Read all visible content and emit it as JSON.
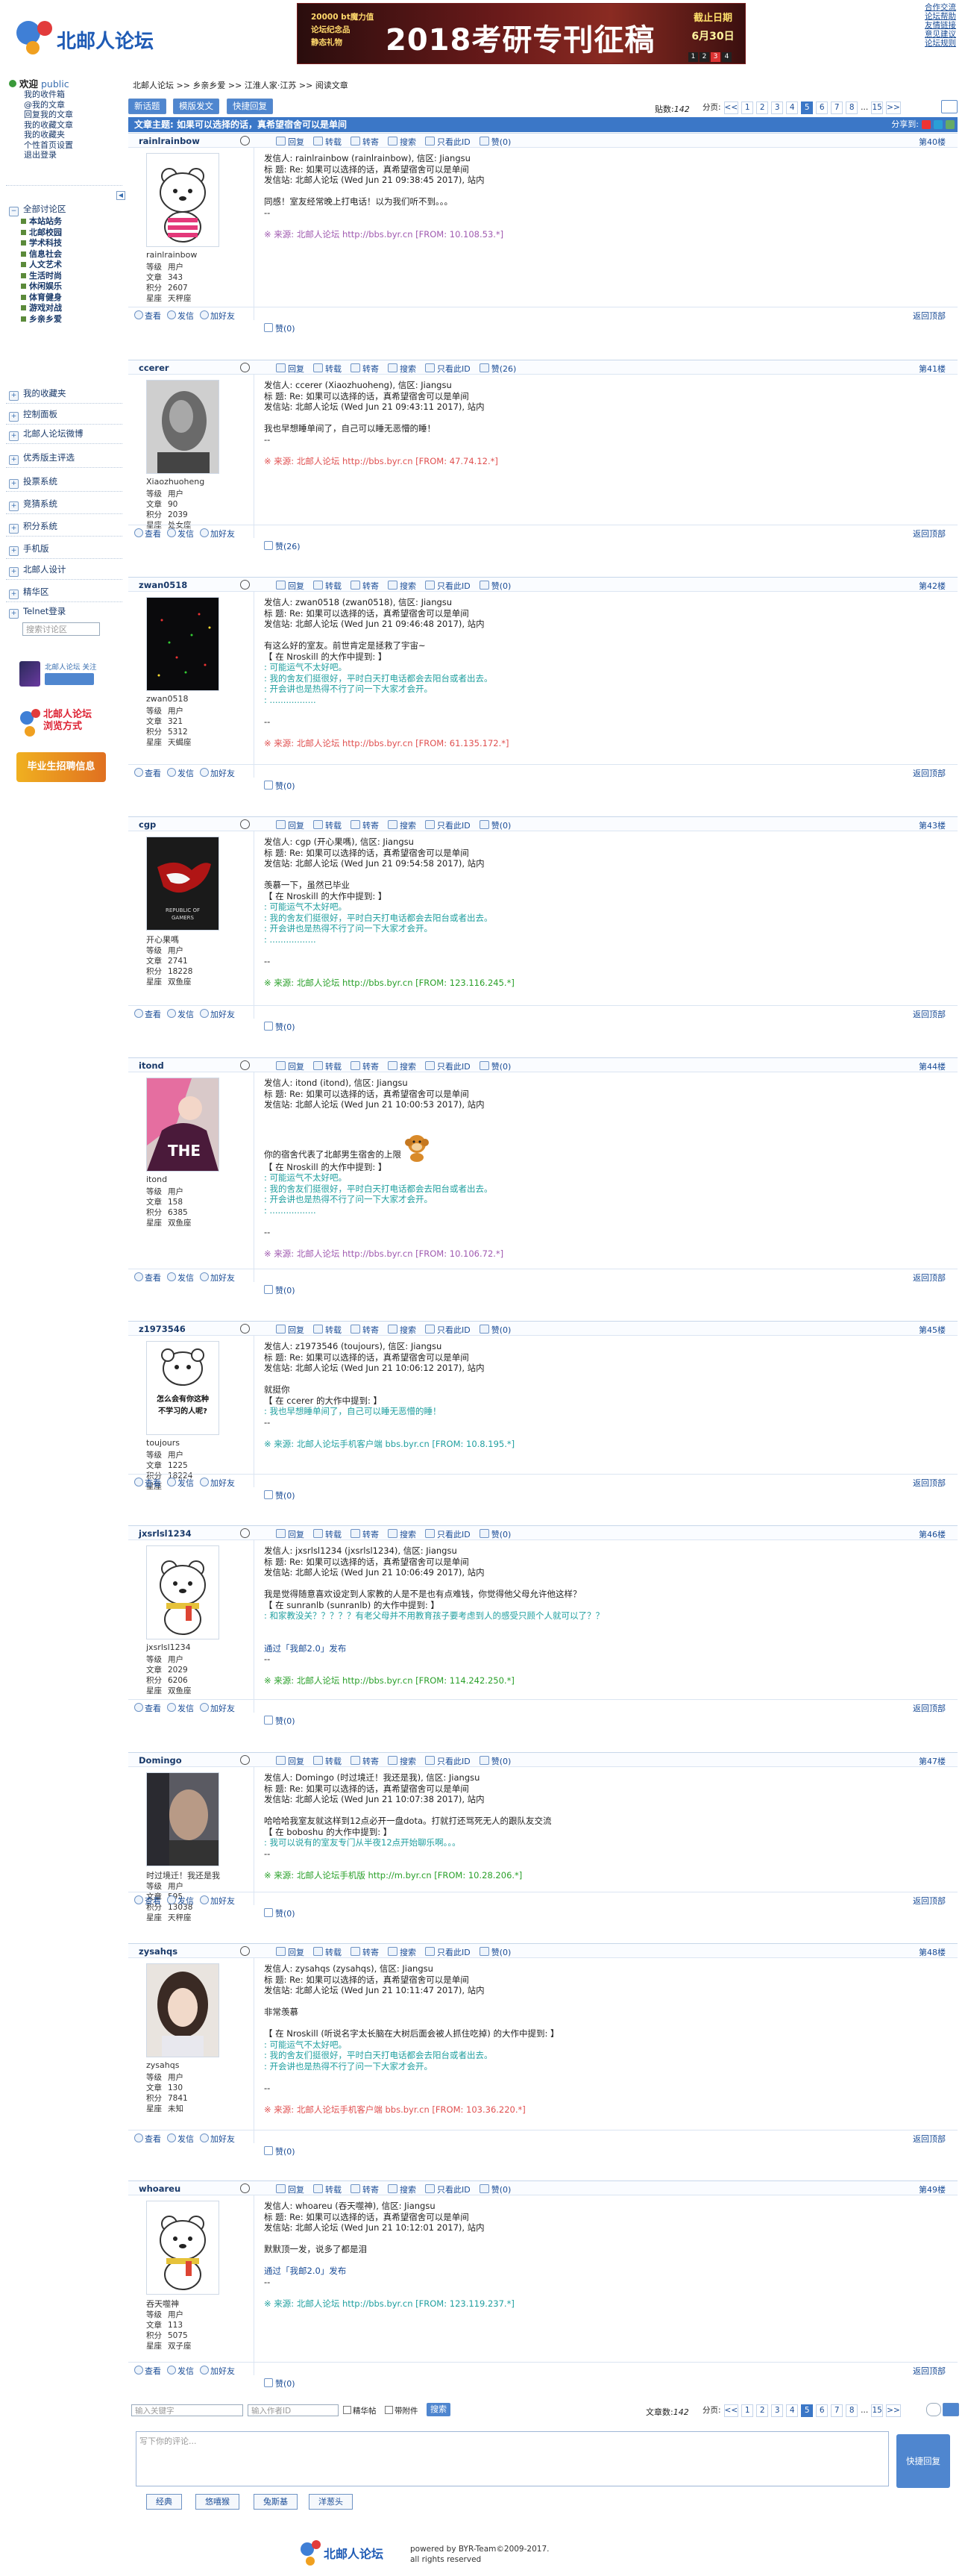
{
  "header": {
    "logo_text": "北邮人论坛",
    "banner": {
      "big": "2018考研专刊征稿",
      "line1": "20000 bt魔力值",
      "line2": "论坛纪念品",
      "line3": "静态礼物",
      "deadline_label": "截止日期",
      "deadline_date": "6月30日",
      "digits": [
        "1",
        "2",
        "3",
        "4"
      ]
    },
    "top_links": [
      "合作交流",
      "论坛帮助",
      "友情链接",
      "意见建议",
      "论坛规则"
    ]
  },
  "sidebar": {
    "welcome": "欢迎",
    "user": "public",
    "user_menu": [
      "我的收件箱",
      "@我的文章",
      "回复我的文章",
      "我的收藏文章",
      "我的收藏夹",
      "个性首页设置",
      "退出登录"
    ],
    "forum_all": "全部讨论区",
    "boards": [
      "本站站务",
      "北邮校园",
      "学术科技",
      "信息社会",
      "人文艺术",
      "生活时尚",
      "休闲娱乐",
      "体育健身",
      "游戏对战",
      "乡亲乡爱"
    ],
    "menu": [
      "我的收藏夹",
      "控制面板",
      "北邮人论坛微博",
      "优秀版主评选",
      "投票系统",
      "竞猜系统",
      "积分系统",
      "手机版",
      "北邮人设计",
      "精华区",
      "Telnet登录"
    ],
    "search_placeholder": "搜索讨论区",
    "promo1": "北邮人论坛 关注我",
    "promo2": "北邮人论坛 浏览方式",
    "promo3": "毕业生招聘信息"
  },
  "breadcrumb": [
    "北邮人论坛",
    "乡亲乡爱",
    "江淮人家·江苏",
    "阅读文章"
  ],
  "toolbar": {
    "new": "新话题",
    "template": "模版发文",
    "quick": "快捷回复",
    "posts_label": "贴数:",
    "posts_value": "142",
    "page_label": "分页:"
  },
  "pager": [
    "<<",
    "1",
    "2",
    "3",
    "4",
    "5",
    "6",
    "7",
    "8",
    "...",
    "15",
    ">>"
  ],
  "pager_current": "5",
  "thread_title": "文章主题: 如果可以选择的话，真希望宿舍可以是单间",
  "share_label": "分享到:",
  "post_actions": [
    "回复",
    "转载",
    "转寄",
    "搜索",
    "只看此ID",
    "赞(0)"
  ],
  "footer_actions": [
    "查看",
    "发信",
    "加好友"
  ],
  "totop": "返回顶部",
  "stat_labels": [
    "等级",
    "文章",
    "积分",
    "星座"
  ],
  "posts": [
    {
      "user": "rainlrainbow",
      "nick": "rainlrainbow",
      "floor": "第40楼",
      "level": "用户",
      "articles": "343",
      "score": "2607",
      "star": "天秤座",
      "like": "赞(0)",
      "lines": [
        [
          "l",
          "发信人: rainlrainbow (rainlrainbow), 信区: Jiangsu"
        ],
        [
          "l",
          "标  题: Re: 如果可以选择的话，真希望宿舍可以是单间"
        ],
        [
          "l",
          "发信站: 北邮人论坛 (Wed Jun 21 09:38:45 2017), 站内"
        ],
        [
          "b",
          ""
        ],
        [
          "l",
          "同感！室友经常晚上打电话！以为我们听不到。。。"
        ],
        [
          "l",
          "--"
        ],
        [
          "b",
          ""
        ],
        [
          "s",
          "※ 来源: 北邮人论坛 http://bbs.byr.cn [FROM: 10.108.53.*]",
          "src3"
        ]
      ]
    },
    {
      "user": "ccerer",
      "nick": "Xiaozhuoheng",
      "floor": "第41楼",
      "level": "用户",
      "articles": "90",
      "score": "2039",
      "star": "处女座",
      "like": "赞(26)",
      "lines": [
        [
          "l",
          "发信人: ccerer (Xiaozhuoheng), 信区: Jiangsu"
        ],
        [
          "l",
          "标  题: Re: 如果可以选择的话，真希望宿舍可以是单间"
        ],
        [
          "l",
          "发信站: 北邮人论坛 (Wed Jun 21 09:43:11 2017), 站内"
        ],
        [
          "b",
          ""
        ],
        [
          "l",
          "我也早想睡单间了，自己可以睡无恶懵的睡！"
        ],
        [
          "l",
          "--"
        ],
        [
          "b",
          ""
        ],
        [
          "s",
          "※ 来源: 北邮人论坛 http://bbs.byr.cn [FROM: 47.74.12.*]",
          "src2"
        ]
      ]
    },
    {
      "user": "zwan0518",
      "nick": "zwan0518",
      "floor": "第42楼",
      "level": "用户",
      "articles": "321",
      "score": "5312",
      "star": "天蝎座",
      "like": "赞(0)",
      "lines": [
        [
          "l",
          "发信人: zwan0518 (zwan0518), 信区: Jiangsu"
        ],
        [
          "l",
          "标  题: Re: 如果可以选择的话，真希望宿舍可以是单间"
        ],
        [
          "l",
          "发信站: 北邮人论坛 (Wed Jun 21 09:46:48 2017), 站内"
        ],
        [
          "b",
          ""
        ],
        [
          "l",
          "有这么好的室友。前世肯定是拯救了宇宙~"
        ],
        [
          "l",
          "【 在 Nroskill 的大作中提到: 】"
        ],
        [
          "q",
          ": 可能运气不太好吧。"
        ],
        [
          "q",
          ": 我的舍友们挺很好，平时白天打电话都会去阳台或者出去。"
        ],
        [
          "q",
          ": 开会讲也是热得不行了问一下大家才会开。"
        ],
        [
          "q",
          ": ................."
        ],
        [
          "b",
          ""
        ],
        [
          "l",
          "--"
        ],
        [
          "b",
          ""
        ],
        [
          "s",
          "※ 来源: 北邮人论坛 http://bbs.byr.cn [FROM: 61.135.172.*]",
          "src2"
        ]
      ]
    },
    {
      "user": "cgp",
      "nick": "开心果嗎",
      "floor": "第43楼",
      "level": "用户",
      "articles": "2741",
      "score": "18228",
      "star": "双鱼座",
      "like": "赞(0)",
      "lines": [
        [
          "l",
          "发信人: cgp (开心果嗎), 信区: Jiangsu"
        ],
        [
          "l",
          "标  题: Re: 如果可以选择的话，真希望宿舍可以是单间"
        ],
        [
          "l",
          "发信站: 北邮人论坛 (Wed Jun 21 09:54:58 2017), 站内"
        ],
        [
          "b",
          ""
        ],
        [
          "l",
          "羡慕一下，虽然已毕业"
        ],
        [
          "l",
          "【 在 Nroskill 的大作中提到: 】"
        ],
        [
          "q",
          ": 可能运气不太好吧。"
        ],
        [
          "q",
          ": 我的舍友们挺很好，平时白天打电话都会去阳台或者出去。"
        ],
        [
          "q",
          ": 开会讲也是热得不行了问一下大家才会开。"
        ],
        [
          "q",
          ": ................."
        ],
        [
          "b",
          ""
        ],
        [
          "l",
          "--"
        ],
        [
          "b",
          ""
        ],
        [
          "s",
          "※ 来源: 北邮人论坛 http://bbs.byr.cn [FROM: 123.116.245.*]",
          "src1"
        ]
      ]
    },
    {
      "user": "itond",
      "nick": "itond",
      "floor": "第44楼",
      "level": "用户",
      "articles": "158",
      "score": "6385",
      "star": "双鱼座",
      "like": "赞(0)",
      "lines": [
        [
          "l",
          "发信人: itond (itond), 信区: Jiangsu"
        ],
        [
          "l",
          "标  题: Re: 如果可以选择的话，真希望宿舍可以是单间"
        ],
        [
          "l",
          "发信站: 北邮人论坛 (Wed Jun 21 10:00:53 2017), 站内"
        ],
        [
          "b",
          ""
        ],
        [
          "b",
          ""
        ],
        [
          "e",
          "你的宿舍代表了北邮男生宿舍的上限"
        ],
        [
          "l",
          "【 在 Nroskill 的大作中提到: 】"
        ],
        [
          "q",
          ": 可能运气不太好吧。"
        ],
        [
          "q",
          ": 我的舍友们挺很好，平时白天打电话都会去阳台或者出去。"
        ],
        [
          "q",
          ": 开会讲也是热得不行了问一下大家才会开。"
        ],
        [
          "q",
          ": ................."
        ],
        [
          "b",
          ""
        ],
        [
          "l",
          "--"
        ],
        [
          "b",
          ""
        ],
        [
          "s",
          "※ 来源: 北邮人论坛 http://bbs.byr.cn [FROM: 10.106.72.*]",
          "src3"
        ]
      ]
    },
    {
      "user": "z1973546",
      "nick": "toujours",
      "floor": "第45楼",
      "level": "用户",
      "articles": "1225",
      "score": "18224",
      "star": "",
      "like": "赞(0)",
      "lines": [
        [
          "l",
          "发信人: z1973546 (toujours), 信区: Jiangsu"
        ],
        [
          "l",
          "标  题: Re: 如果可以选择的话，真希望宿舍可以是单间"
        ],
        [
          "l",
          "发信站: 北邮人论坛 (Wed Jun 21 10:06:12 2017), 站内"
        ],
        [
          "b",
          ""
        ],
        [
          "l",
          "就挺你"
        ],
        [
          "l",
          "【 在 ccerer 的大作中提到: 】"
        ],
        [
          "q",
          ": 我也早想睡单间了，自己可以睡无恶懵的睡！"
        ],
        [
          "l",
          "--"
        ],
        [
          "b",
          ""
        ],
        [
          "s",
          "※ 来源: 北邮人论坛手机客户端 bbs.byr.cn [FROM: 10.8.195.*]",
          "qq"
        ]
      ]
    },
    {
      "user": "jxsrlsl1234",
      "nick": "jxsrlsl1234",
      "floor": "第46楼",
      "level": "用户",
      "articles": "2029",
      "score": "6206",
      "star": "双鱼座",
      "like": "赞(0)",
      "lines": [
        [
          "l",
          "发信人: jxsrlsl1234 (jxsrlsl1234), 信区: Jiangsu"
        ],
        [
          "l",
          "标  题: Re: 如果可以选择的话，真希望宿舍可以是单间"
        ],
        [
          "l",
          "发信站: 北邮人论坛 (Wed Jun 21 10:06:49 2017), 站内"
        ],
        [
          "b",
          ""
        ],
        [
          "l",
          "我是觉得随意喜欢设定到人家教的人是不是也有点难钱，你觉得他父母允许他这样？"
        ],
        [
          "l",
          "【 在 sunranlb (sunranlb) 的大作中提到: 】"
        ],
        [
          "q",
          ": 和家教没关？？？？？有老父母并不用教育孩子要考虑到人的感受只顾个人就可以了？？"
        ],
        [
          "b",
          ""
        ],
        [
          "b",
          ""
        ],
        [
          "a",
          "通过「我邮2.0」发布"
        ],
        [
          "l",
          "--"
        ],
        [
          "b",
          ""
        ],
        [
          "s",
          "※ 来源: 北邮人论坛 http://bbs.byr.cn [FROM: 114.242.250.*]",
          "src1"
        ]
      ]
    },
    {
      "user": "Domingo",
      "nick": "时过境迁！我还是我",
      "floor": "第47楼",
      "level": "用户",
      "articles": "595",
      "score": "13038",
      "star": "天秤座",
      "like": "赞(0)",
      "lines": [
        [
          "l",
          "发信人: Domingo (时过境迁！我还是我), 信区: Jiangsu"
        ],
        [
          "l",
          "标  题: Re: 如果可以选择的话，真希望宿舍可以是单间"
        ],
        [
          "l",
          "发信站: 北邮人论坛 (Wed Jun 21 10:07:38 2017), 站内"
        ],
        [
          "b",
          ""
        ],
        [
          "l",
          "哈哈哈我室友就这样到12点必开一盘dota。打就打还骂死无人的跟队友交流"
        ],
        [
          "l",
          "【 在 boboshu 的大作中提到: 】"
        ],
        [
          "q",
          ": 我可以说有的室友专门从半夜12点开始聊乐啊。。。"
        ],
        [
          "l",
          "--"
        ],
        [
          "b",
          ""
        ],
        [
          "s",
          "※ 来源: 北邮人论坛手机版 http://m.byr.cn [FROM: 10.28.206.*]",
          "src1"
        ]
      ]
    },
    {
      "user": "zysahqs",
      "nick": "zysahqs",
      "floor": "第48楼",
      "level": "用户",
      "articles": "130",
      "score": "7841",
      "star": "未知",
      "like": "赞(0)",
      "lines": [
        [
          "l",
          "发信人: zysahqs (zysahqs), 信区: Jiangsu"
        ],
        [
          "l",
          "标  题: Re: 如果可以选择的话，真希望宿舍可以是单间"
        ],
        [
          "l",
          "发信站: 北邮人论坛 (Wed Jun 21 10:11:47 2017), 站内"
        ],
        [
          "b",
          ""
        ],
        [
          "l",
          "非常羡慕"
        ],
        [
          "b",
          ""
        ],
        [
          "l",
          "【 在 Nroskill (听说名字太长脑在大树后面会被人抓住吃掉) 的大作中提到: 】"
        ],
        [
          "q",
          ": 可能运气不太好吧。"
        ],
        [
          "q",
          ": 我的舍友们挺很好，平时白天打电话都会去阳台或者出去。"
        ],
        [
          "q",
          ": 开会讲也是热得不行了问一下大家才会开。"
        ],
        [
          "b",
          ""
        ],
        [
          "l",
          "--"
        ],
        [
          "b",
          ""
        ],
        [
          "s",
          "※ 来源: 北邮人论坛手机客户端 bbs.byr.cn [FROM: 103.36.220.*]",
          "src2"
        ]
      ]
    },
    {
      "user": "whoareu",
      "nick": "吞天噬神",
      "floor": "第49楼",
      "level": "用户",
      "articles": "113",
      "score": "5075",
      "star": "双子座",
      "like": "赞(0)",
      "lines": [
        [
          "l",
          "发信人: whoareu (吞天噬神), 信区: Jiangsu"
        ],
        [
          "l",
          "标  题: Re: 如果可以选择的话，真希望宿舍可以是单间"
        ],
        [
          "l",
          "发信站: 北邮人论坛 (Wed Jun 21 10:12:01 2017), 站内"
        ],
        [
          "b",
          ""
        ],
        [
          "l",
          "默默顶一发，说多了都是泪"
        ],
        [
          "b",
          ""
        ],
        [
          "a",
          "通过「我邮2.0」发布"
        ],
        [
          "l",
          "--"
        ],
        [
          "b",
          ""
        ],
        [
          "s",
          "※ 来源: 北邮人论坛 http://bbs.byr.cn [FROM: 123.119.237.*]",
          "qq"
        ]
      ]
    }
  ],
  "bottom": {
    "search_keyword": "输入关键字",
    "search_author": "输入作者ID",
    "chk_good": "精华帖",
    "chk_attach": "带附件",
    "search_btn": "搜索",
    "count_label": "文章数:",
    "count_value": "142",
    "page_label": "分页:",
    "reply_placeholder": "写下你的评论...",
    "reply_btn": "快捷回复",
    "skins": [
      "经典",
      "悠嘻猴",
      "兔斯基",
      "洋葱头"
    ]
  },
  "footer": {
    "logo": "北邮人论坛",
    "powered": "powered by BYR-Team©2009-2017.",
    "rights": "all rights reserved"
  }
}
